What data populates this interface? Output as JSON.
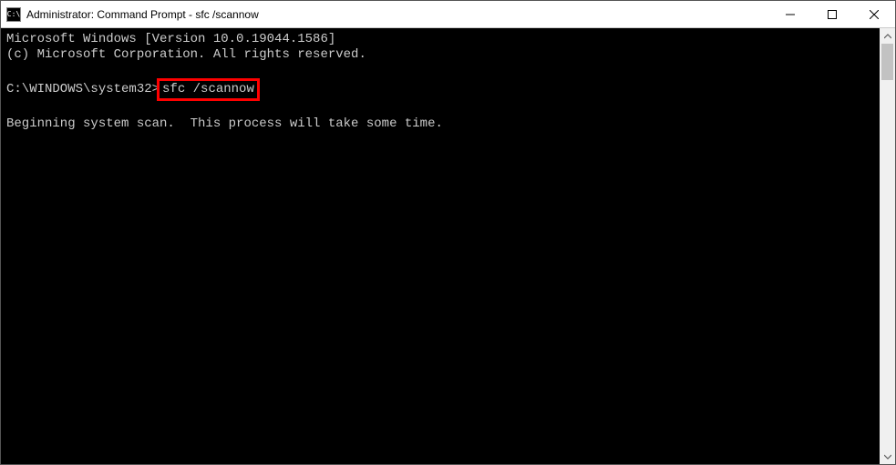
{
  "titlebar": {
    "title": "Administrator: Command Prompt - sfc  /scannow"
  },
  "terminal": {
    "line1": "Microsoft Windows [Version 10.0.19044.1586]",
    "line2": "(c) Microsoft Corporation. All rights reserved.",
    "blank1": "",
    "prompt": "C:\\WINDOWS\\system32>",
    "command": "sfc /scannow",
    "blank2": "",
    "status": "Beginning system scan.  This process will take some time."
  }
}
